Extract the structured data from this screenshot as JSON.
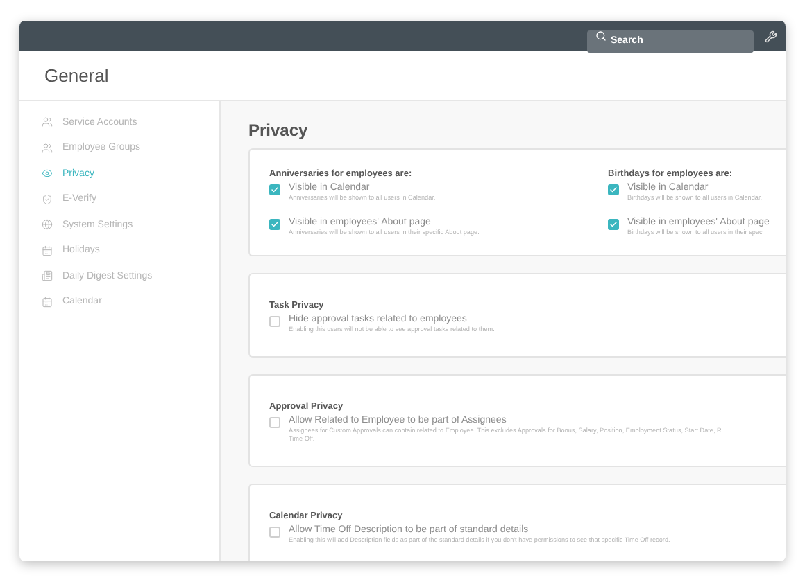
{
  "topbar": {
    "search": {
      "placeholder": "Search"
    }
  },
  "header": {
    "title": "General"
  },
  "sidebar": {
    "items": [
      {
        "label": "Service Accounts",
        "selected": false
      },
      {
        "label": "Employee Groups",
        "selected": false
      },
      {
        "label": "Privacy",
        "selected": true
      },
      {
        "label": "E-Verify",
        "selected": false
      },
      {
        "label": "System Settings",
        "selected": false
      },
      {
        "label": "Holidays",
        "selected": false
      },
      {
        "label": "Daily Digest Settings",
        "selected": false
      },
      {
        "label": "Calendar",
        "selected": false
      }
    ]
  },
  "page": {
    "title": "Privacy"
  },
  "sections": [
    {
      "kind": "columns",
      "columns": [
        {
          "title": "Anniversaries for employees are:",
          "options": [
            {
              "label": "Visible in Calendar",
              "description_lines": [
                "Anniversaries will be shown to all users in Calendar."
              ],
              "checked": true
            },
            {
              "label": "Visible in employees' About page",
              "description_lines": [
                "Anniversaries will be shown to all users in their specific About page."
              ],
              "checked": true
            }
          ]
        },
        {
          "title": "Birthdays for employees are:",
          "options": [
            {
              "label": "Visible in Calendar",
              "description_lines": [
                "Birthdays will be shown to all users in Calendar."
              ],
              "checked": true
            },
            {
              "label": "Visible in employees' About page",
              "description_lines": [
                "Birthdays will be shown to all users in their spec"
              ],
              "checked": true
            }
          ]
        }
      ]
    },
    {
      "kind": "single",
      "title": "Task Privacy",
      "options": [
        {
          "label": "Hide approval tasks related to employees",
          "description_lines": [
            "Enabling this users will not be able to see approval tasks related to them."
          ],
          "checked": false
        }
      ]
    },
    {
      "kind": "single",
      "title": "Approval Privacy",
      "options": [
        {
          "label": "Allow Related to Employee to be part of Assignees",
          "description_lines": [
            "Assignees for Custom Approvals can contain related to Employee. This excludes Approvals for Bonus, Salary, Position, Employment Status, Start Date, R",
            "Time Off."
          ],
          "checked": false
        }
      ]
    },
    {
      "kind": "single",
      "title": "Calendar Privacy",
      "options": [
        {
          "label": "Allow Time Off Description to be part of standard details",
          "description_lines": [
            "Enabling this will add Description fields as part of the standard details if you don't have permissions to see that specific Time Off record."
          ],
          "checked": false
        }
      ]
    }
  ]
}
